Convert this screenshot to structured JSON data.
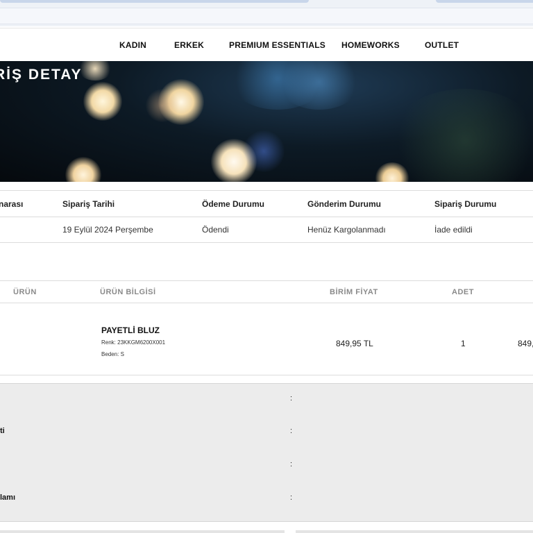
{
  "nav": {
    "items": [
      "KADIN",
      "ERKEK",
      "PREMIUM ESSENTIALS",
      "HOMEWORKS",
      "OUTLET"
    ]
  },
  "hero": {
    "title": "RİŞ DETAY"
  },
  "order_info": {
    "headers": [
      "narası",
      "Sipariş Tarihi",
      "Ödeme Durumu",
      "Gönderim Durumu",
      "Sipariş Durumu"
    ],
    "values": [
      "",
      "19 Eylül 2024 Perşembe",
      "Ödendi",
      "Henüz Kargolanmadı",
      "İade edildi"
    ]
  },
  "products": {
    "headers": [
      "ÜRÜN",
      "ÜRÜN BİLGİSİ",
      "BİRİM FİYAT",
      "ADET"
    ],
    "item": {
      "name": "PAYETLİ BLUZ",
      "color": "Renk: 23KKGM6200X001",
      "size": "Beden: S",
      "unit_price": "849,95 TL",
      "quantity": "1",
      "total": "849,"
    }
  },
  "summary": {
    "labels": [
      "",
      "ti",
      "",
      "lamı"
    ],
    "separator": ":"
  }
}
